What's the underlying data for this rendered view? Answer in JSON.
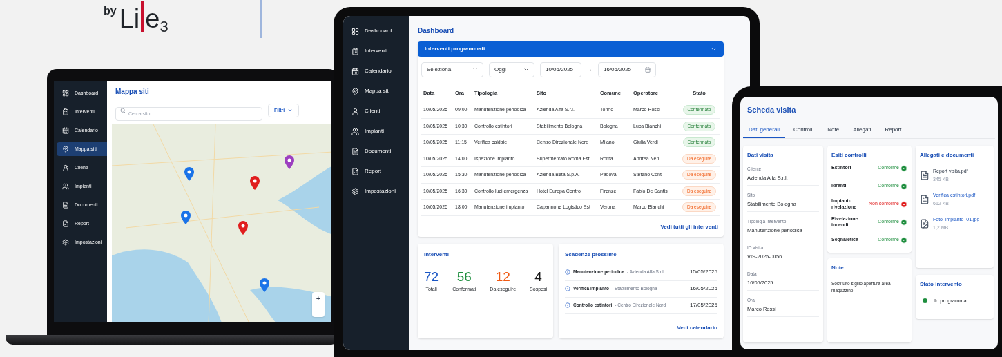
{
  "logo": {
    "by": "by",
    "name_start": "Li",
    "name_end": "e",
    "subscript": "3"
  },
  "laptop": {
    "sidebar": [
      {
        "label": "Dashboard",
        "selected": false
      },
      {
        "label": "Interventi",
        "selected": false
      },
      {
        "label": "Calendario",
        "selected": false
      },
      {
        "label": "Mappa siti",
        "selected": true
      },
      {
        "label": "Clienti",
        "selected": false
      },
      {
        "label": "Impianti",
        "selected": false
      },
      {
        "label": "Documenti",
        "selected": false
      },
      {
        "label": "Report",
        "selected": false
      },
      {
        "label": "Impostazioni",
        "selected": false
      }
    ],
    "title": "Mappa siti",
    "search": {
      "placeholder": "Cerca sito..."
    },
    "filter_button": "Filtri",
    "map": {
      "pins": [
        {
          "color": "#1a73e8"
        },
        {
          "color": "#e01e1e"
        },
        {
          "color": "#9c3fc0"
        },
        {
          "color": "#1a73e8"
        },
        {
          "color": "#e01e1e"
        },
        {
          "color": "#1a73e8"
        }
      ],
      "zoom_in": "+",
      "zoom_out": "−"
    }
  },
  "tablet": {
    "sidebar": [
      {
        "label": "Dashboard",
        "selected": false
      },
      {
        "label": "Interventi",
        "selected": false
      },
      {
        "label": "Calendario",
        "selected": false
      },
      {
        "label": "Mappa siti",
        "selected": false
      },
      {
        "label": "Clienti",
        "selected": false
      },
      {
        "label": "Impianti",
        "selected": false
      },
      {
        "label": "Documenti",
        "selected": false
      },
      {
        "label": "Report",
        "selected": false
      },
      {
        "label": "Impostazioni",
        "selected": false
      }
    ],
    "title": "Dashboard",
    "panel": {
      "title": "Interventi programmati",
      "expanded": true
    },
    "filters": {
      "select": "Seleziona",
      "period": "Oggi",
      "date_from": "10/05/2025",
      "arrow": "→",
      "date_to": "16/05/2025"
    },
    "table": {
      "columns": [
        "Data",
        "Ora",
        "Tipologia",
        "Sito",
        "Comune",
        "Operatore",
        "Stato"
      ],
      "rows": [
        {
          "cells": [
            "10/05/2025",
            "09:00",
            "Manutenzione periodica",
            "Azienda Alfa S.r.l.",
            "Torino",
            "Marco Rossi"
          ],
          "status": {
            "label": "Confermato",
            "kind": "confirmed"
          }
        },
        {
          "cells": [
            "10/05/2025",
            "10:30",
            "Controllo estintori",
            "Stabilimento Bologna",
            "Bologna",
            "Luca Bianchi"
          ],
          "status": {
            "label": "Confermato",
            "kind": "confirmed"
          }
        },
        {
          "cells": [
            "10/05/2025",
            "11:15",
            "Verifica caldaie",
            "Centro Direzionale Nord",
            "Milano",
            "Giulia Verdi"
          ],
          "status": {
            "label": "Confermato",
            "kind": "confirmed"
          }
        },
        {
          "cells": [
            "10/05/2025",
            "14:00",
            "Ispezione impianto",
            "Supermercato Roma Est",
            "Roma",
            "Andrea Neri"
          ],
          "status": {
            "label": "Da eseguire",
            "kind": "pending"
          }
        },
        {
          "cells": [
            "10/05/2025",
            "15:30",
            "Manutenzione periodica",
            "Azienda Beta S.p.A.",
            "Padova",
            "Stefano Conti"
          ],
          "status": {
            "label": "Da eseguire",
            "kind": "pending"
          }
        },
        {
          "cells": [
            "10/05/2025",
            "16:30",
            "Controllo luci emergenza",
            "Hotel Europa Centro",
            "Firenze",
            "Fabio De Santis"
          ],
          "status": {
            "label": "Da eseguire",
            "kind": "pending"
          }
        },
        {
          "cells": [
            "10/05/2025",
            "18:00",
            "Manutenzione impianto",
            "Capannone Logistico Est",
            "Verona",
            "Marco Bianchi"
          ],
          "status": {
            "label": "Da eseguire",
            "kind": "pending"
          }
        }
      ]
    },
    "view_all": "Vedi tutti gli interventi",
    "stats": {
      "title": "Interventi",
      "items": [
        {
          "value": "72",
          "label": "Totali",
          "color": "#1a56c4"
        },
        {
          "value": "56",
          "label": "Confermati",
          "color": "#1e8e3e"
        },
        {
          "value": "12",
          "label": "Da eseguire",
          "color": "#f05a14"
        },
        {
          "value": "4",
          "label": "Sospesi",
          "color": "#1a1a1a"
        }
      ]
    },
    "deadlines": {
      "title": "Scadenze prossime",
      "items": [
        {
          "title": "Manutenzione periodica",
          "site": "- Azienda Alfa S.r.l.",
          "date": "15/05/2025"
        },
        {
          "title": "Verifica impianto",
          "site": "- Stabilimento Bologna",
          "date": "16/05/2025"
        },
        {
          "title": "Controllo estintori",
          "site": "- Centro Direzionale Nord",
          "date": "17/05/2025"
        }
      ],
      "link": "Vedi calendario"
    }
  },
  "phone": {
    "title": "Scheda visita",
    "tabs": [
      {
        "label": "Dati generali",
        "selected": true
      },
      {
        "label": "Controlli",
        "selected": false
      },
      {
        "label": "Note",
        "selected": false
      },
      {
        "label": "Allegati",
        "selected": false
      },
      {
        "label": "Report",
        "selected": false
      }
    ],
    "details": {
      "title": "Dati visita",
      "fields": [
        {
          "label": "Cliente",
          "value": "Azienda Alfa S.r.l."
        },
        {
          "label": "Sito",
          "value": "Stabilimento Bologna"
        },
        {
          "label": "Tipologia intervento",
          "value": "Manutenzione periodica"
        },
        {
          "label": "ID visita",
          "value": "VIS-2025-0056"
        },
        {
          "label": "Data",
          "value": "10/05/2025"
        },
        {
          "label": "Ora",
          "value": "Marco Rossi"
        }
      ]
    },
    "checks": {
      "title": "Esiti controlli",
      "items": [
        {
          "name": "Estintori",
          "result": "Conforme",
          "compliant": true
        },
        {
          "name": "Idranti",
          "result": "Conforme",
          "compliant": true
        },
        {
          "name": "Impianto rivelazione",
          "result": "Non conforme",
          "compliant": false
        },
        {
          "name": "Rivelazione incendi",
          "result": "Conforme",
          "compliant": true
        },
        {
          "name": "Segnaletica",
          "result": "Conforme",
          "compliant": true
        }
      ]
    },
    "notes": {
      "title": "Note",
      "text": "Sostituito sigillo apertura area magazzino."
    },
    "attachments": {
      "title": "Allegati e documenti",
      "files": [
        {
          "name": "Report visita.pdf",
          "size": "345 KB",
          "kind": "document",
          "linked": false
        },
        {
          "name": "Verifica estintori.pdf",
          "size": "612 KB",
          "kind": "document",
          "linked": true
        },
        {
          "name": "Foto_impianto_01.jpg",
          "size": "1,2 MB",
          "kind": "image",
          "linked": true
        }
      ]
    },
    "status": {
      "title": "Stato intervento",
      "label": "In programma",
      "color": "#1e8e3e"
    }
  }
}
